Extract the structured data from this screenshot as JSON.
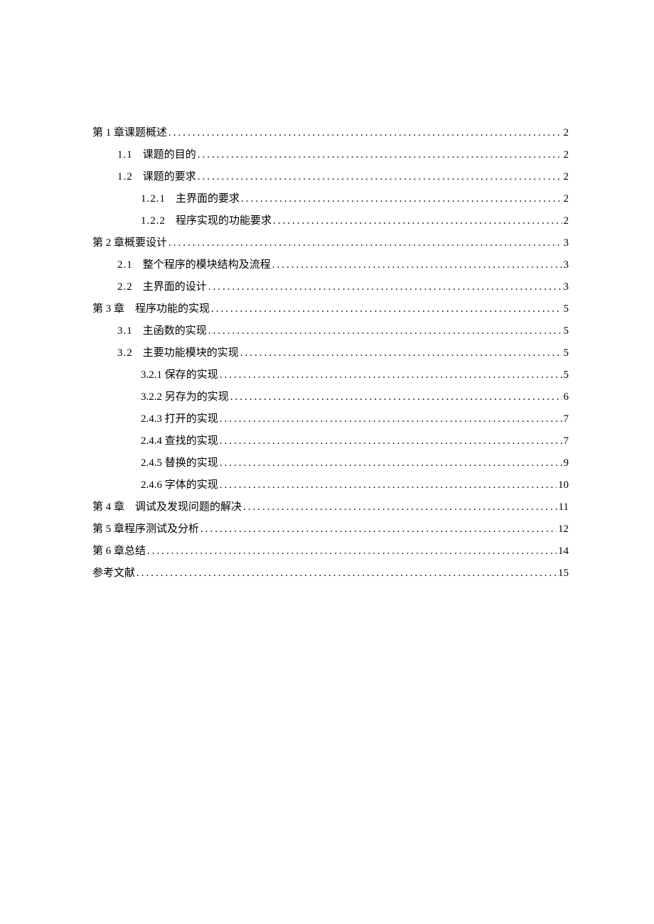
{
  "toc": [
    {
      "level": 0,
      "num": "",
      "title": "第 1 章课题概述",
      "page": "2"
    },
    {
      "level": 1,
      "num": "1.1",
      "title": "课题的目的 ",
      "page": "2"
    },
    {
      "level": 1,
      "num": "1.2",
      "title": "课题的要求 ",
      "page": "2"
    },
    {
      "level": 2,
      "num": "1.2.1",
      "title": "主界面的要求 ",
      "page": "2"
    },
    {
      "level": 2,
      "num": "1.2.2",
      "title": "程序实现的功能要求 ",
      "page": "2"
    },
    {
      "level": 0,
      "num": "",
      "title": "第 2 章概要设计",
      "page": "3"
    },
    {
      "level": 1,
      "num": "2.1",
      "title": "整个程序的模块结构及流程 ",
      "page": "3"
    },
    {
      "level": 1,
      "num": "2.2",
      "title": "主界面的设计 ",
      "page": "3"
    },
    {
      "level": 0,
      "num": "",
      "title": "第 3 章　程序功能的实现",
      "page": "5"
    },
    {
      "level": 1,
      "num": "3.1",
      "title": "主函数的实现 ",
      "page": "5"
    },
    {
      "level": 1,
      "num": "3.2",
      "title": "主要功能模块的实现 ",
      "page": "5"
    },
    {
      "level": 2,
      "num": "",
      "title": "3.2.1 保存的实现 ",
      "page": "5"
    },
    {
      "level": 2,
      "num": "",
      "title": "3.2.2 另存为的实现 ",
      "page": "6"
    },
    {
      "level": 2,
      "num": "",
      "title": "2.4.3 打开的实现 ",
      "page": "7"
    },
    {
      "level": 2,
      "num": "",
      "title": "2.4.4 查找的实现 ",
      "page": "7"
    },
    {
      "level": 2,
      "num": "",
      "title": "2.4.5 替换的实现 ",
      "page": "9"
    },
    {
      "level": 2,
      "num": "",
      "title": "2.4.6 字体的实现 ",
      "page": "10"
    },
    {
      "level": 0,
      "num": "",
      "title": "第 4 章　调试及发现问题的解决",
      "page": "11"
    },
    {
      "level": 0,
      "num": "",
      "title": "第 5 章程序测试及分析 ",
      "page": "12"
    },
    {
      "level": 0,
      "num": "",
      "title": "第 6 章总结 ",
      "page": "14"
    },
    {
      "level": 0,
      "num": "",
      "title": "参考文献",
      "page": "15"
    }
  ]
}
